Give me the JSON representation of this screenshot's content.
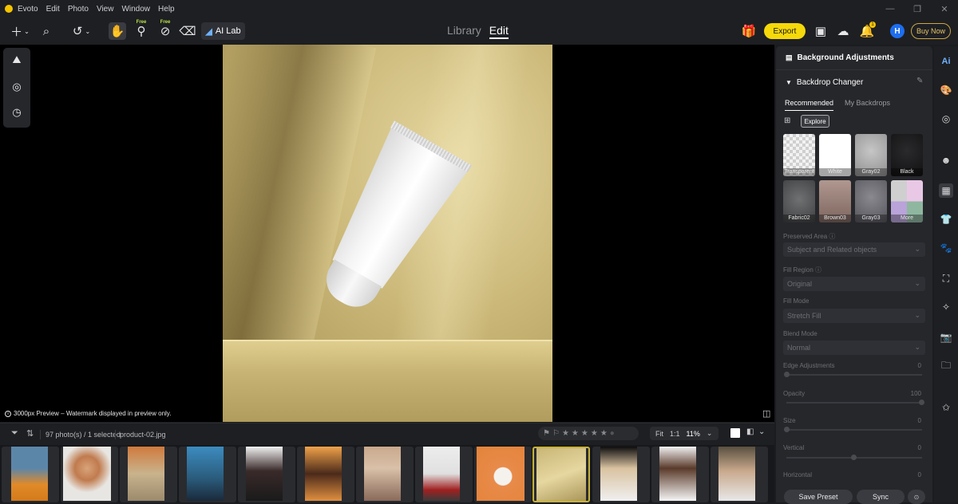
{
  "menubar": {
    "app": "Evoto",
    "items": [
      "Edit",
      "Photo",
      "View",
      "Window",
      "Help"
    ]
  },
  "toolbar": {
    "free_badge": "Free",
    "ailab_label": "AI Lab",
    "library_tab": "Library",
    "edit_tab": "Edit",
    "export_label": "Export",
    "buy_label": "Buy Now",
    "avatar_letter": "H",
    "notify_count": "1"
  },
  "canvas": {
    "preview_note": "3000px Preview – Watermark displayed in preview only."
  },
  "filmbar": {
    "photo_count": "97 photo(s) / 1 selected",
    "filename": "product-02.jpg",
    "fit": "Fit",
    "ratio": "1:1",
    "zoom": "11%"
  },
  "panel": {
    "title": "Background Adjustments",
    "section": "Backdrop Changer",
    "tabs": [
      "Recommended",
      "My Backdrops"
    ],
    "explore": "Explore",
    "swatches": [
      {
        "label": "Transparent",
        "color": "#e8e8e8"
      },
      {
        "label": "White",
        "color": "#ffffff"
      },
      {
        "label": "Gray02",
        "color": "#a9a9aa"
      },
      {
        "label": "Black",
        "color": "#1a1a1c"
      },
      {
        "label": "Fabric02",
        "color": "#5a5b5c"
      },
      {
        "label": "Brown03",
        "color": "#8d7670"
      },
      {
        "label": "Gray03",
        "color": "#6c6b72"
      },
      {
        "label": "More",
        "color": "#d7b8d6"
      }
    ],
    "preserved_area": {
      "label": "Preserved Area",
      "value": "Subject and Related objects"
    },
    "fill_region": {
      "label": "Fill Region",
      "value": "Original"
    },
    "fill_mode": {
      "label": "Fill Mode",
      "value": "Stretch Fill"
    },
    "blend_mode": {
      "label": "Blend Mode",
      "value": "Normal"
    },
    "edge": {
      "label": "Edge Adjustments",
      "value": "0"
    },
    "opacity": {
      "label": "Opacity",
      "value": "100"
    },
    "size": {
      "label": "Size",
      "value": "0"
    },
    "vertical": {
      "label": "Vertical",
      "value": "0"
    },
    "horizontal": {
      "label": "Horizontal",
      "value": "0"
    },
    "save_preset": "Save Preset",
    "sync": "Sync"
  },
  "colors": {
    "accent": "#f5d90a",
    "panel_bg": "#26272b",
    "app_bg": "#1e1f22",
    "avatar": "#1d6ef0"
  }
}
